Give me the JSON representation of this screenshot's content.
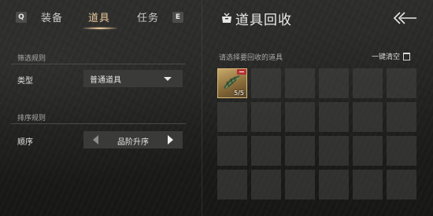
{
  "tabs": {
    "prev_key": "Q",
    "next_key": "E",
    "items": [
      {
        "label": "装备"
      },
      {
        "label": "道具"
      },
      {
        "label": "任务"
      }
    ],
    "active_index": 1,
    "active_color": "#e7c79a"
  },
  "filter": {
    "section_title": "筛选规则",
    "type_label": "类型",
    "type_value": "普通道具"
  },
  "sort": {
    "section_title": "排序规则",
    "order_label": "顺序",
    "order_value": "品阶升序"
  },
  "recycle": {
    "title": "道具回收",
    "hint": "请选择要回收的道具",
    "clear_label": "一键清空",
    "slots": [
      {
        "filled": true,
        "count": "5/5",
        "icon": "herb-item-icon"
      },
      {
        "filled": false
      },
      {
        "filled": false
      },
      {
        "filled": false
      },
      {
        "filled": false
      },
      {
        "filled": false
      },
      {
        "filled": false
      },
      {
        "filled": false
      },
      {
        "filled": false
      },
      {
        "filled": false
      },
      {
        "filled": false
      },
      {
        "filled": false
      },
      {
        "filled": false
      },
      {
        "filled": false
      },
      {
        "filled": false
      },
      {
        "filled": false
      },
      {
        "filled": false
      },
      {
        "filled": false
      },
      {
        "filled": false
      },
      {
        "filled": false
      },
      {
        "filled": false
      },
      {
        "filled": false
      },
      {
        "filled": false
      },
      {
        "filled": false
      }
    ]
  },
  "icons": {
    "title_icon": "recycle-box-icon",
    "back": "back-arrow-icon",
    "clear": "trash-icon"
  }
}
